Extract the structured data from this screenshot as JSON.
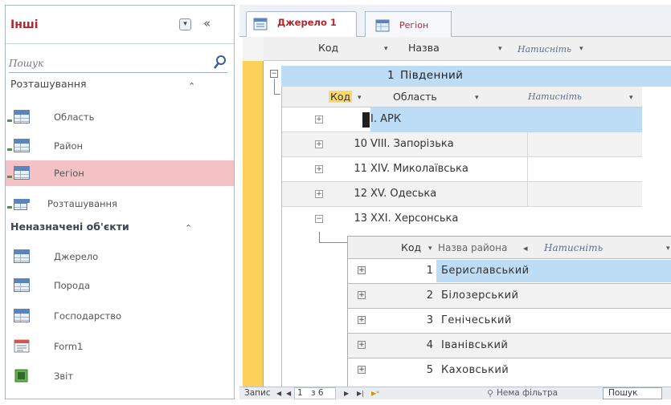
{
  "nav": {
    "title": "Інші",
    "search_placeholder": "Пошук",
    "group1": {
      "label": "Розташування",
      "arrow": "⌃"
    },
    "group1_items": [
      {
        "label": "Область"
      },
      {
        "label": "Район"
      },
      {
        "label": "Регіон",
        "selected": true
      }
    ],
    "group1_query": {
      "label": "Розташування"
    },
    "group2": {
      "label": "Неназначені об'єкти",
      "arrow": "⌃"
    },
    "group2_items": [
      {
        "label": "Джерело",
        "icon": "table-icon"
      },
      {
        "label": "Порода",
        "icon": "table-icon"
      },
      {
        "label": "Господарство",
        "icon": "table-icon"
      },
      {
        "label": "Form1",
        "icon": "form-icon"
      },
      {
        "label": "Звіт",
        "icon": "report-icon"
      }
    ]
  },
  "tabs": [
    {
      "label": "Джерело 1",
      "active": true
    },
    {
      "label": "Регіон",
      "active": false
    }
  ],
  "level1": {
    "headers": {
      "code": "Код",
      "name": "Назва",
      "click": "Натисніть"
    },
    "row": {
      "code": "1",
      "name": "Південний"
    }
  },
  "level2": {
    "headers": {
      "code": "Код",
      "name": "Область",
      "click": "Натисніть"
    },
    "rows": [
      {
        "code": "9",
        "name": "I. АРК"
      },
      {
        "code": "10",
        "name": "VIII. Запорізька"
      },
      {
        "code": "11",
        "name": "XIV. Миколаївська"
      },
      {
        "code": "12",
        "name": "XV. Одеська"
      },
      {
        "code": "13",
        "name": "XXI. Херсонська"
      }
    ]
  },
  "level3": {
    "headers": {
      "code": "Код",
      "name": "Назва района",
      "click": "Натисніть"
    },
    "rows": [
      {
        "code": "1",
        "name": "Бериславський"
      },
      {
        "code": "2",
        "name": "Білозерський"
      },
      {
        "code": "3",
        "name": "Генічеський"
      },
      {
        "code": "4",
        "name": "Іванівський"
      },
      {
        "code": "5",
        "name": "Каховський"
      }
    ]
  },
  "status": {
    "record_label": "Запис",
    "first": "◀",
    "prev": "◀",
    "position": "1",
    "of": "з 6",
    "next": "▶",
    "last": "▶|",
    "new": "▶*",
    "filter": "Нема фільтра",
    "search": "Пошук"
  }
}
